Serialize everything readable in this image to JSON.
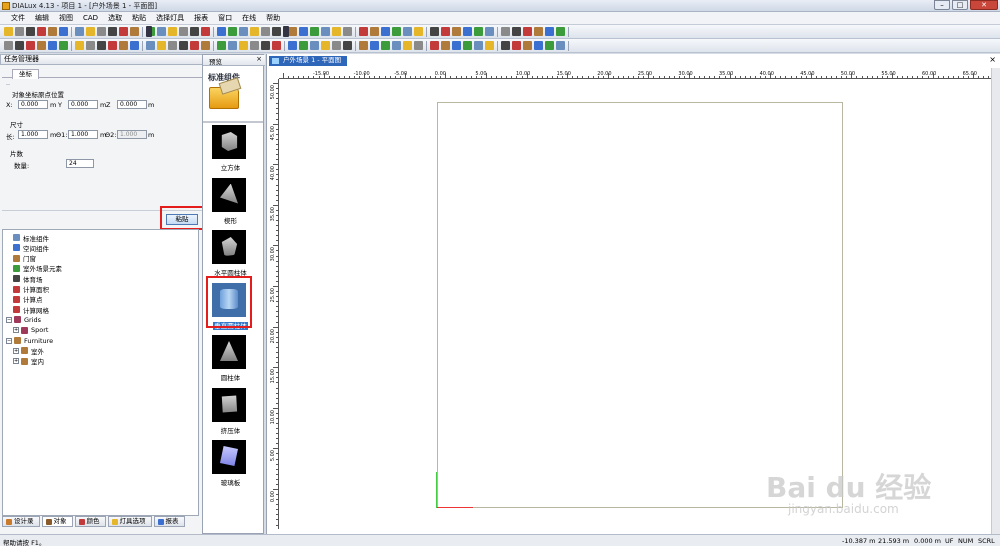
{
  "window": {
    "title": "DIALux 4.13 - 项目 1 - [户外场景 1 - 平面图]",
    "controls": [
      "–",
      "□",
      "✕"
    ]
  },
  "menu": [
    "文件",
    "编辑",
    "视图",
    "CAD",
    "选取",
    "粘贴",
    "选择灯具",
    "报表",
    "窗口",
    "在线",
    "帮助"
  ],
  "task_manager": {
    "title": "任务管理器",
    "tab": "坐标",
    "position_group": "对象坐标原点位置",
    "x_label": "X:",
    "x_value": "0.000",
    "x_unit": "m",
    "y_label": "Y",
    "y_value": "0.000",
    "y_unit": "m",
    "z_label": "Z",
    "z_value": "0.000",
    "z_unit": "m",
    "size_group": "尺寸",
    "len_label": "长:",
    "len_value": "1.000",
    "len_unit": "m",
    "d1_label": "Θ1:",
    "d1_value": "1.000",
    "d1_unit": "m",
    "d2_label": "Θ2:",
    "d2_value": "1.000",
    "d2_unit": "m",
    "sections_group": "片数",
    "count_label": "数量:",
    "count_value": "24",
    "paste_button": "粘贴"
  },
  "tree": [
    {
      "label": "标准组件",
      "color": "#6a8fbf",
      "level": 1,
      "expander": ""
    },
    {
      "label": "空间组件",
      "color": "#3b6fd0",
      "level": 1,
      "expander": ""
    },
    {
      "label": "门窗",
      "color": "#b07a3a",
      "level": 1,
      "expander": ""
    },
    {
      "label": "室外场景元素",
      "color": "#3c9c3c",
      "level": 1,
      "expander": ""
    },
    {
      "label": "体育场",
      "color": "#444444",
      "level": 1,
      "expander": ""
    },
    {
      "label": "计算面积",
      "color": "#c23a3a",
      "level": 1,
      "expander": ""
    },
    {
      "label": "计算点",
      "color": "#c23a3a",
      "level": 1,
      "expander": ""
    },
    {
      "label": "计算网格",
      "color": "#c23a3a",
      "level": 1,
      "expander": ""
    },
    {
      "label": "Grids",
      "color": "#a03a5a",
      "level": 0,
      "expander": "−"
    },
    {
      "label": "Sport",
      "color": "#a03a5a",
      "level": 1,
      "expander": "+"
    },
    {
      "label": "Furniture",
      "color": "#b07a3a",
      "level": 0,
      "expander": "−"
    },
    {
      "label": "室外",
      "color": "#b07a3a",
      "level": 1,
      "expander": "+"
    },
    {
      "label": "室内",
      "color": "#b07a3a",
      "level": 1,
      "expander": "+"
    }
  ],
  "bottom_tabs": [
    {
      "label": "设计录",
      "color": "#c97a2a"
    },
    {
      "label": "对象",
      "color": "#8a5a2a"
    },
    {
      "label": "颜色",
      "color": "#c23a3a"
    },
    {
      "label": "灯具选项",
      "color": "#e5b52a"
    },
    {
      "label": "报表",
      "color": "#3b6fd0"
    }
  ],
  "preview": {
    "title": "预览",
    "close": "×",
    "header": "标准组件",
    "items": [
      {
        "label": "立方体"
      },
      {
        "label": "楔形"
      },
      {
        "label": "水平圆柱体"
      },
      {
        "label": "垂直圆柱体",
        "selected": true
      },
      {
        "label": "圆柱体"
      },
      {
        "label": "挤压体"
      },
      {
        "label": "玻璃板"
      }
    ]
  },
  "canvas": {
    "tab": "户外场景 1 - 平面图",
    "close": "×",
    "hruler": [
      "-15.00",
      "-10.00",
      "-5.00",
      "0.00",
      "5.00",
      "10.00",
      "15.00",
      "20.00",
      "25.00",
      "30.00",
      "35.00",
      "40.00",
      "45.00",
      "50.00",
      "55.00",
      "60.00",
      "65.00"
    ],
    "vruler": [
      "50.00",
      "45.00",
      "40.00",
      "35.00",
      "30.00",
      "25.00",
      "20.00",
      "15.00",
      "10.00",
      "5.00",
      "0.00"
    ]
  },
  "status": {
    "help": "帮助请按 F1。",
    "x": "-10.387 m",
    "y": "21.593 m",
    "z": "0.000 m",
    "uf": "UF",
    "num": "NUM",
    "scrl": "SCRL"
  },
  "watermark": {
    "brand": "Bai du 经验",
    "url": "jingyan.baidu.com"
  }
}
